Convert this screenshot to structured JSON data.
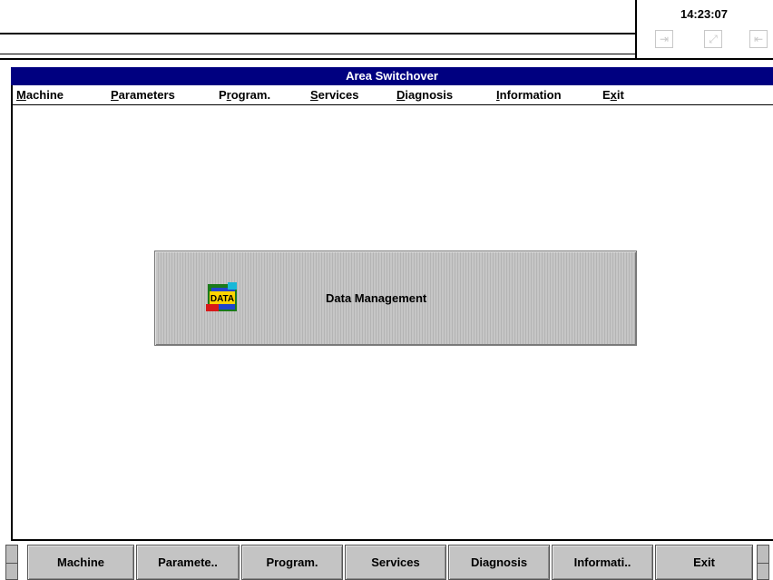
{
  "status": {
    "clock": "14:23:07",
    "icons": [
      "enter-icon",
      "zoom-icon",
      "exit-door-icon"
    ]
  },
  "window": {
    "title": "Area Switchover"
  },
  "menu": {
    "items": [
      {
        "key": "M",
        "rest": "achine"
      },
      {
        "key": "P",
        "rest": "arameters"
      },
      {
        "pre": "P",
        "key": "r",
        "rest": "ogram."
      },
      {
        "key": "S",
        "rest": "ervices"
      },
      {
        "key": "D",
        "rest": "iagnosis"
      },
      {
        "key": "I",
        "rest": "nformation"
      },
      {
        "pre": "E",
        "key": "x",
        "rest": "it"
      }
    ]
  },
  "main": {
    "data_management_label": "Data Management",
    "icon_text": "DATA"
  },
  "softkeys": [
    "Machine",
    "Paramete..",
    "Program.",
    "Services",
    "Diagnosis",
    "Informati..",
    "Exit"
  ]
}
